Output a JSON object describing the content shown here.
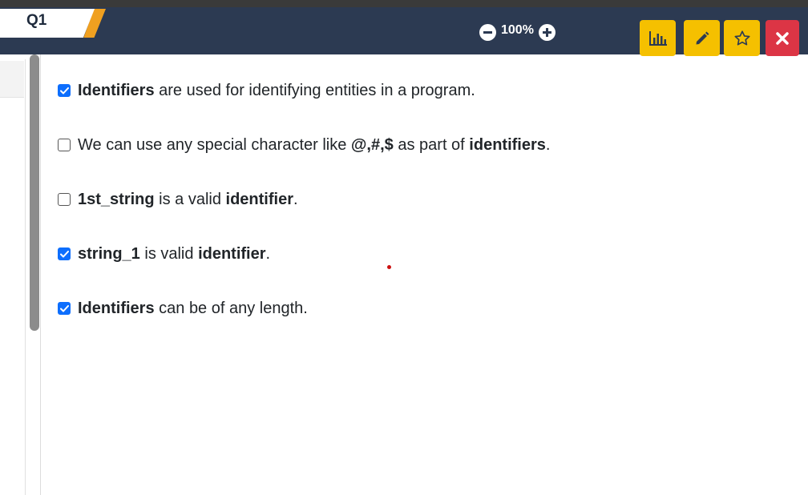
{
  "question_tab": {
    "label": "Q1"
  },
  "zoom": {
    "level": "100%",
    "zoom_out_icon": "minus-circle-icon",
    "zoom_in_icon": "plus-circle-icon"
  },
  "header_buttons": [
    {
      "icon": "bar-chart-icon",
      "color": "#f5c000"
    },
    {
      "icon": "pencil-icon",
      "color": "#f5c000"
    },
    {
      "icon": "star-icon",
      "color": "#f5c000"
    },
    {
      "icon": "close-icon",
      "color": "#dc3545"
    }
  ],
  "options": [
    {
      "checked": true,
      "segments": [
        {
          "text": "Identifiers",
          "bold": true
        },
        {
          "text": " are used for identifying entities in a program.",
          "bold": false
        }
      ]
    },
    {
      "checked": false,
      "segments": [
        {
          "text": "We can use any special character like ",
          "bold": false
        },
        {
          "text": "@,#,$",
          "bold": true
        },
        {
          "text": " as part of ",
          "bold": false
        },
        {
          "text": "identifiers",
          "bold": true
        },
        {
          "text": ".",
          "bold": false
        }
      ]
    },
    {
      "checked": false,
      "segments": [
        {
          "text": "1st_string",
          "bold": true
        },
        {
          "text": " is a valid ",
          "bold": false
        },
        {
          "text": "identifier",
          "bold": true
        },
        {
          "text": ".",
          "bold": false
        }
      ]
    },
    {
      "checked": true,
      "segments": [
        {
          "text": "string_1",
          "bold": true
        },
        {
          "text": " is valid ",
          "bold": false
        },
        {
          "text": "identifier",
          "bold": true
        },
        {
          "text": ".",
          "bold": false
        }
      ]
    },
    {
      "checked": true,
      "segments": [
        {
          "text": "Identifiers",
          "bold": true
        },
        {
          "text": " can be of any length.",
          "bold": false
        }
      ]
    }
  ],
  "colors": {
    "header_bg": "#2c3a52",
    "accent_yellow": "#f5c000",
    "close_red": "#dc3545",
    "checkbox_blue": "#0d6efd",
    "tab_accent": "#f0a020"
  }
}
